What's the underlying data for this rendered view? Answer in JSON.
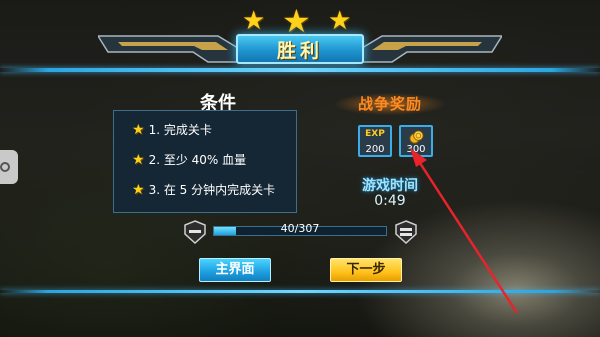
{
  "title": "胜利",
  "stars_earned": 3,
  "conditions": {
    "title": "条件",
    "items": [
      {
        "number": "1.",
        "text": "完成关卡"
      },
      {
        "number": "2.",
        "text": "至少 40% 血量"
      },
      {
        "number": "3.",
        "text": "在 5 分钟内完成关卡"
      }
    ]
  },
  "rewards": {
    "title": "战争奖励",
    "exp_label": "EXP",
    "exp_value": "200",
    "coin_value": "300"
  },
  "game_time": {
    "title": "游戏时间",
    "value": "0:49"
  },
  "experience": {
    "text": "40/307",
    "progress": 0.13
  },
  "buttons": {
    "main_menu": "主界面",
    "next_step": "下一步"
  },
  "colors": {
    "accent_blue": "#2aa6e0",
    "star_gold": "#ffd21a",
    "reward_orange": "#ff8a1f",
    "annotation_arrow": "#e8232a"
  }
}
